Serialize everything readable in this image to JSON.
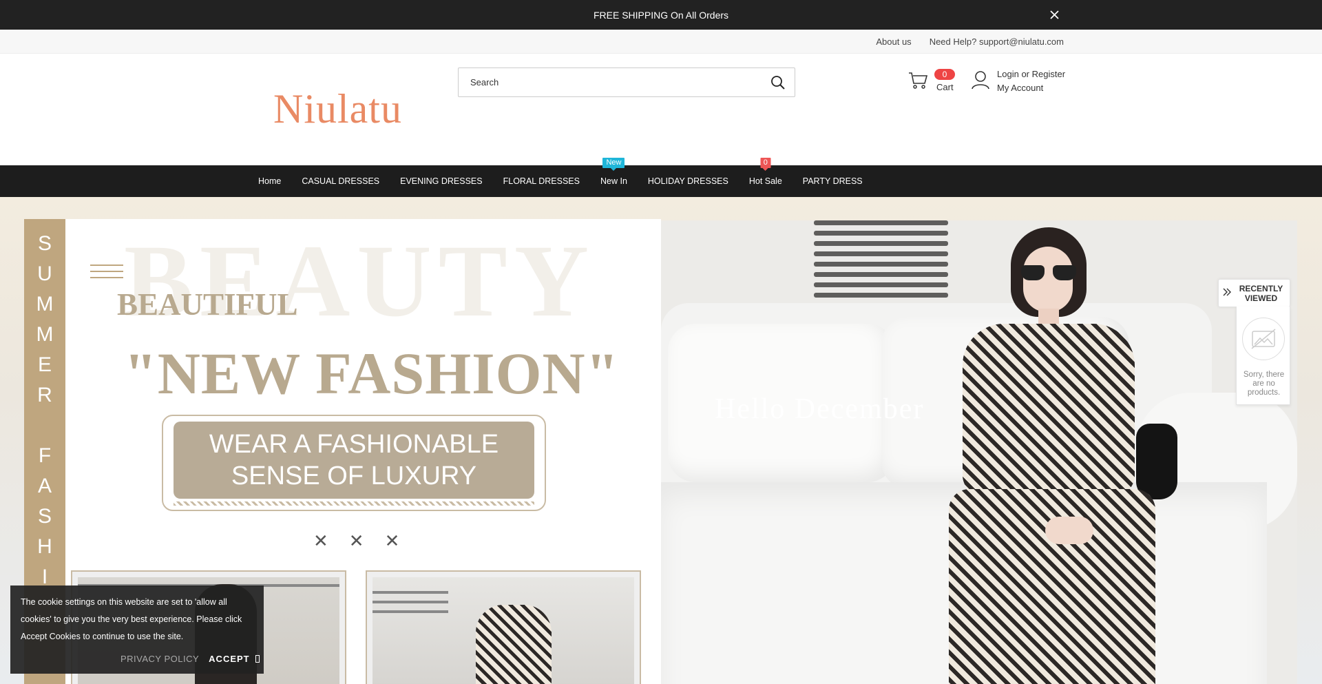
{
  "announcement": {
    "text": "FREE SHIPPING On All Orders",
    "close_icon": "close-icon"
  },
  "toplinks": {
    "about": "About us",
    "help": "Need Help? support@niulatu.com"
  },
  "header": {
    "logo": "Niulatu",
    "search": {
      "placeholder": "Search",
      "value": ""
    },
    "cart": {
      "count": "0",
      "label": "Cart"
    },
    "account": {
      "login": "Login",
      "or": "or",
      "register": "Register",
      "my_account": "My Account"
    }
  },
  "nav": {
    "items": [
      {
        "label": "Home"
      },
      {
        "label": "CASUAL DRESSES"
      },
      {
        "label": "EVENING DRESSES"
      },
      {
        "label": "FLORAL DRESSES"
      },
      {
        "label": "New In",
        "tag": "New"
      },
      {
        "label": "HOLIDAY DRESSES"
      },
      {
        "label": "Hot Sale",
        "tag": "0"
      },
      {
        "label": "PARTY DRESS"
      }
    ]
  },
  "hero": {
    "side_text": "SUMMER FASHI",
    "watermark": "BEAUTY",
    "beautiful": "BEAUTIFUL",
    "headline": "\"NEW FASHION\"",
    "box_line1": "WEAR A FASHIONABLE",
    "box_line2": "SENSE OF LUXURY",
    "decor_marks": [
      "✕",
      "✕",
      "✕"
    ],
    "photo_caption": "Hello December"
  },
  "recently_viewed": {
    "title_line1": "RECENTLY",
    "title_line2": "VIEWED",
    "empty_message": "Sorry, there are no products."
  },
  "cookie": {
    "text": "The cookie settings on this website are set to 'allow all cookies' to give you the very best experience. Please click Accept Cookies to continue to use the site.",
    "policy": "PRIVACY POLICY",
    "accept": "ACCEPT"
  },
  "colors": {
    "accent": "#e98a64",
    "nav_bg": "#1d1d1d",
    "new_tag": "#1fb6d9",
    "hot_tag": "#e55555",
    "hero_gold": "#bfa67f"
  }
}
